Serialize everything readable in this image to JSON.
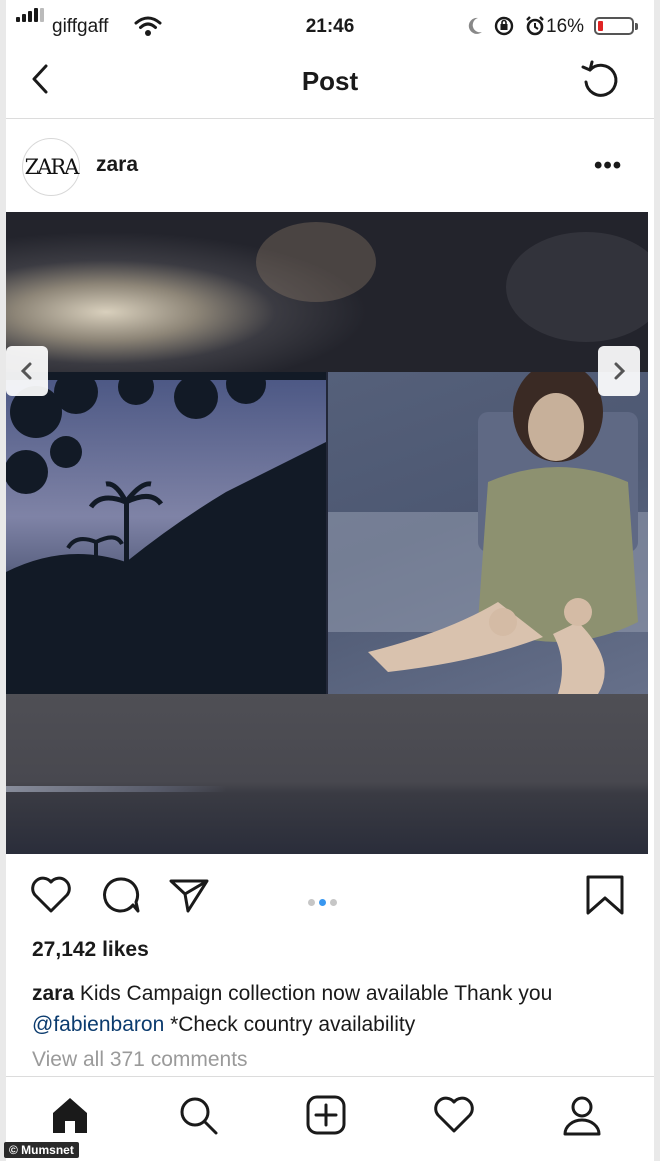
{
  "status_bar": {
    "carrier": "giffgaff",
    "time": "21:46",
    "battery_percent": "16%",
    "battery_level": 0.16,
    "battery_color": "#e02424",
    "icons": [
      "signal-icon",
      "wifi-icon",
      "moon-icon",
      "orientation-lock-icon",
      "alarm-icon",
      "battery-icon"
    ]
  },
  "header": {
    "title": "Post",
    "back_icon": "chevron-left-icon",
    "refresh_icon": "refresh-icon"
  },
  "post": {
    "avatar_text": "ZARA",
    "username": "zara",
    "more_icon": "more-horizontal-icon",
    "carousel": {
      "total": 3,
      "active_index": 1,
      "prev_icon": "chevron-left-icon",
      "next_icon": "chevron-right-icon",
      "active_color": "#3897f0"
    },
    "likes": "27,142 likes",
    "caption": {
      "username": "zara",
      "text_before": " Kids Campaign collection now available Thank you ",
      "mention": "@fabienbaron",
      "text_after": " *Check country availability"
    },
    "view_comments": "View all 371 comments"
  },
  "nav": {
    "items": [
      "home-icon",
      "search-icon",
      "add-post-icon",
      "activity-heart-icon",
      "profile-icon"
    ]
  },
  "watermark": "© Mumsnet"
}
